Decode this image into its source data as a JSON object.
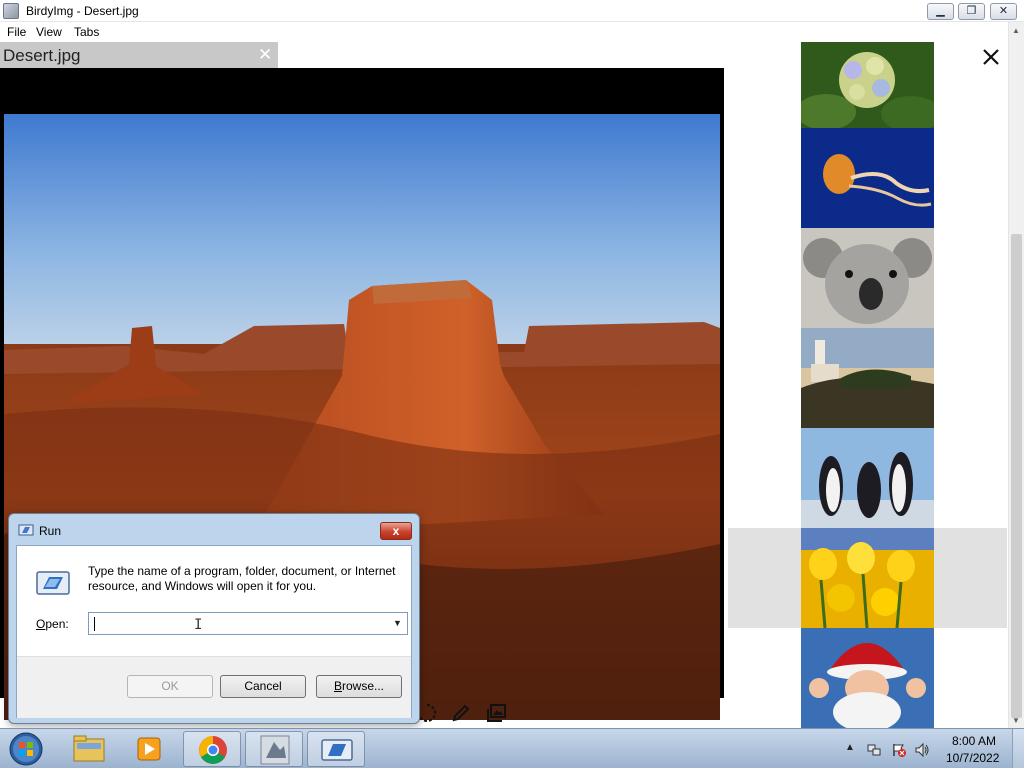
{
  "window": {
    "title": "BirdyImg - Desert.jpg",
    "minimize_label": "▁",
    "maximize_label": "❐",
    "close_label": "✕"
  },
  "menu": {
    "items": [
      "File",
      "View",
      "Tabs"
    ]
  },
  "tab": {
    "label": "Desert.jpg",
    "close_label": "✕"
  },
  "thumbnails": [
    "hydrangea",
    "jellyfish",
    "koala",
    "lighthouse",
    "penguins",
    "tulips",
    "santa"
  ],
  "selected_thumbnail": "tulips",
  "run_dialog": {
    "title": "Run",
    "close_label": "x",
    "description": "Type the name of a program, folder, document, or Internet resource, and Windows will open it for you.",
    "open_label_accel": "O",
    "open_label_rest": "pen:",
    "open_value": "",
    "ok_label": "OK",
    "cancel_label": "Cancel",
    "browse_label_accel": "B",
    "browse_label_rest": "rowse..."
  },
  "taskbar": {
    "apps": [
      "windows-explorer",
      "media-player",
      "chrome",
      "birdyimg",
      "run"
    ],
    "active_app": "run",
    "time": "8:00 AM",
    "date": "10/7/2022"
  },
  "colors": {
    "accent_selection": "#e1e1e1",
    "viewer_background": "#000000",
    "tab_background": "#c8c8c8"
  }
}
